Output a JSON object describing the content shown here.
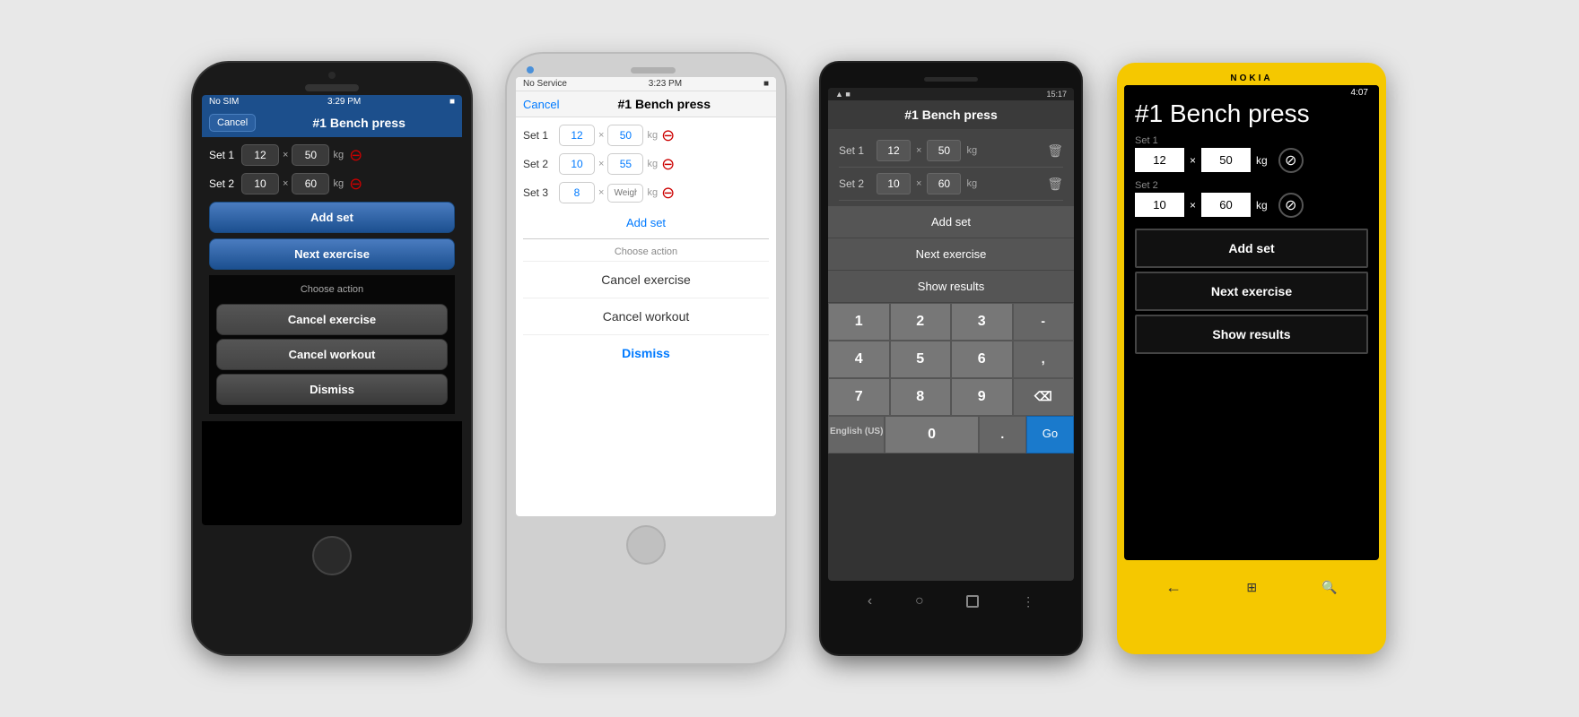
{
  "phone1": {
    "status": {
      "carrier": "No SIM",
      "wifi": "▲",
      "time": "3:29 PM",
      "battery": "■"
    },
    "nav": {
      "cancel": "Cancel",
      "title": "#1 Bench press"
    },
    "sets": [
      {
        "label": "Set 1",
        "reps": "12",
        "weight": "50",
        "unit": "kg"
      },
      {
        "label": "Set 2",
        "reps": "10",
        "weight": "60",
        "unit": "kg"
      }
    ],
    "buttons": {
      "add_set": "Add set",
      "next_exercise": "Next exercise"
    },
    "action_sheet": {
      "header": "Choose action",
      "cancel_exercise": "Cancel exercise",
      "cancel_workout": "Cancel workout",
      "dismiss": "Dismiss"
    }
  },
  "phone2": {
    "status": {
      "carrier": "No Service",
      "wifi": "▲",
      "time": "3:23 PM",
      "battery": "■"
    },
    "nav": {
      "cancel": "Cancel",
      "title": "#1 Bench press"
    },
    "sets": [
      {
        "label": "Set 1",
        "reps": "12",
        "weight": "50",
        "unit": "kg"
      },
      {
        "label": "Set 2",
        "reps": "10",
        "weight": "55",
        "unit": "kg"
      },
      {
        "label": "Set 3",
        "reps": "8",
        "weight": "",
        "unit": "kg"
      }
    ],
    "add_set": "Add set",
    "action_sheet": {
      "header": "Choose action",
      "cancel_exercise": "Cancel exercise",
      "cancel_workout": "Cancel workout",
      "dismiss": "Dismiss"
    }
  },
  "phone3": {
    "status": {
      "icons": "▲ ■",
      "time": "15:17"
    },
    "title": "#1 Bench press",
    "sets": [
      {
        "label": "Set 1",
        "reps": "12",
        "weight": "50",
        "unit": "kg"
      },
      {
        "label": "Set 2",
        "reps": "10",
        "weight": "60",
        "unit": "kg"
      }
    ],
    "buttons": {
      "add_set": "Add set",
      "next_exercise": "Next exercise",
      "show_results": "Show results"
    },
    "keyboard": {
      "rows": [
        [
          "1",
          "2",
          "3",
          "-"
        ],
        [
          "4",
          "5",
          "6",
          ","
        ],
        [
          "7",
          "8",
          "9",
          "⌫"
        ],
        [
          "EN",
          "0",
          ".",
          "Go"
        ]
      ],
      "lang": "English (US)"
    }
  },
  "phone4": {
    "brand": "NOKIA",
    "status": {
      "battery": "🔋",
      "time": "4:07"
    },
    "title": "#1 Bench press",
    "sets": [
      {
        "label": "Set 1",
        "reps": "12",
        "weight": "50",
        "unit": "kg"
      },
      {
        "label": "Set 2",
        "reps": "10",
        "weight": "60",
        "unit": "kg"
      }
    ],
    "buttons": {
      "add_set": "Add set",
      "next_exercise": "Next exercise",
      "show_results": "Show results"
    }
  }
}
